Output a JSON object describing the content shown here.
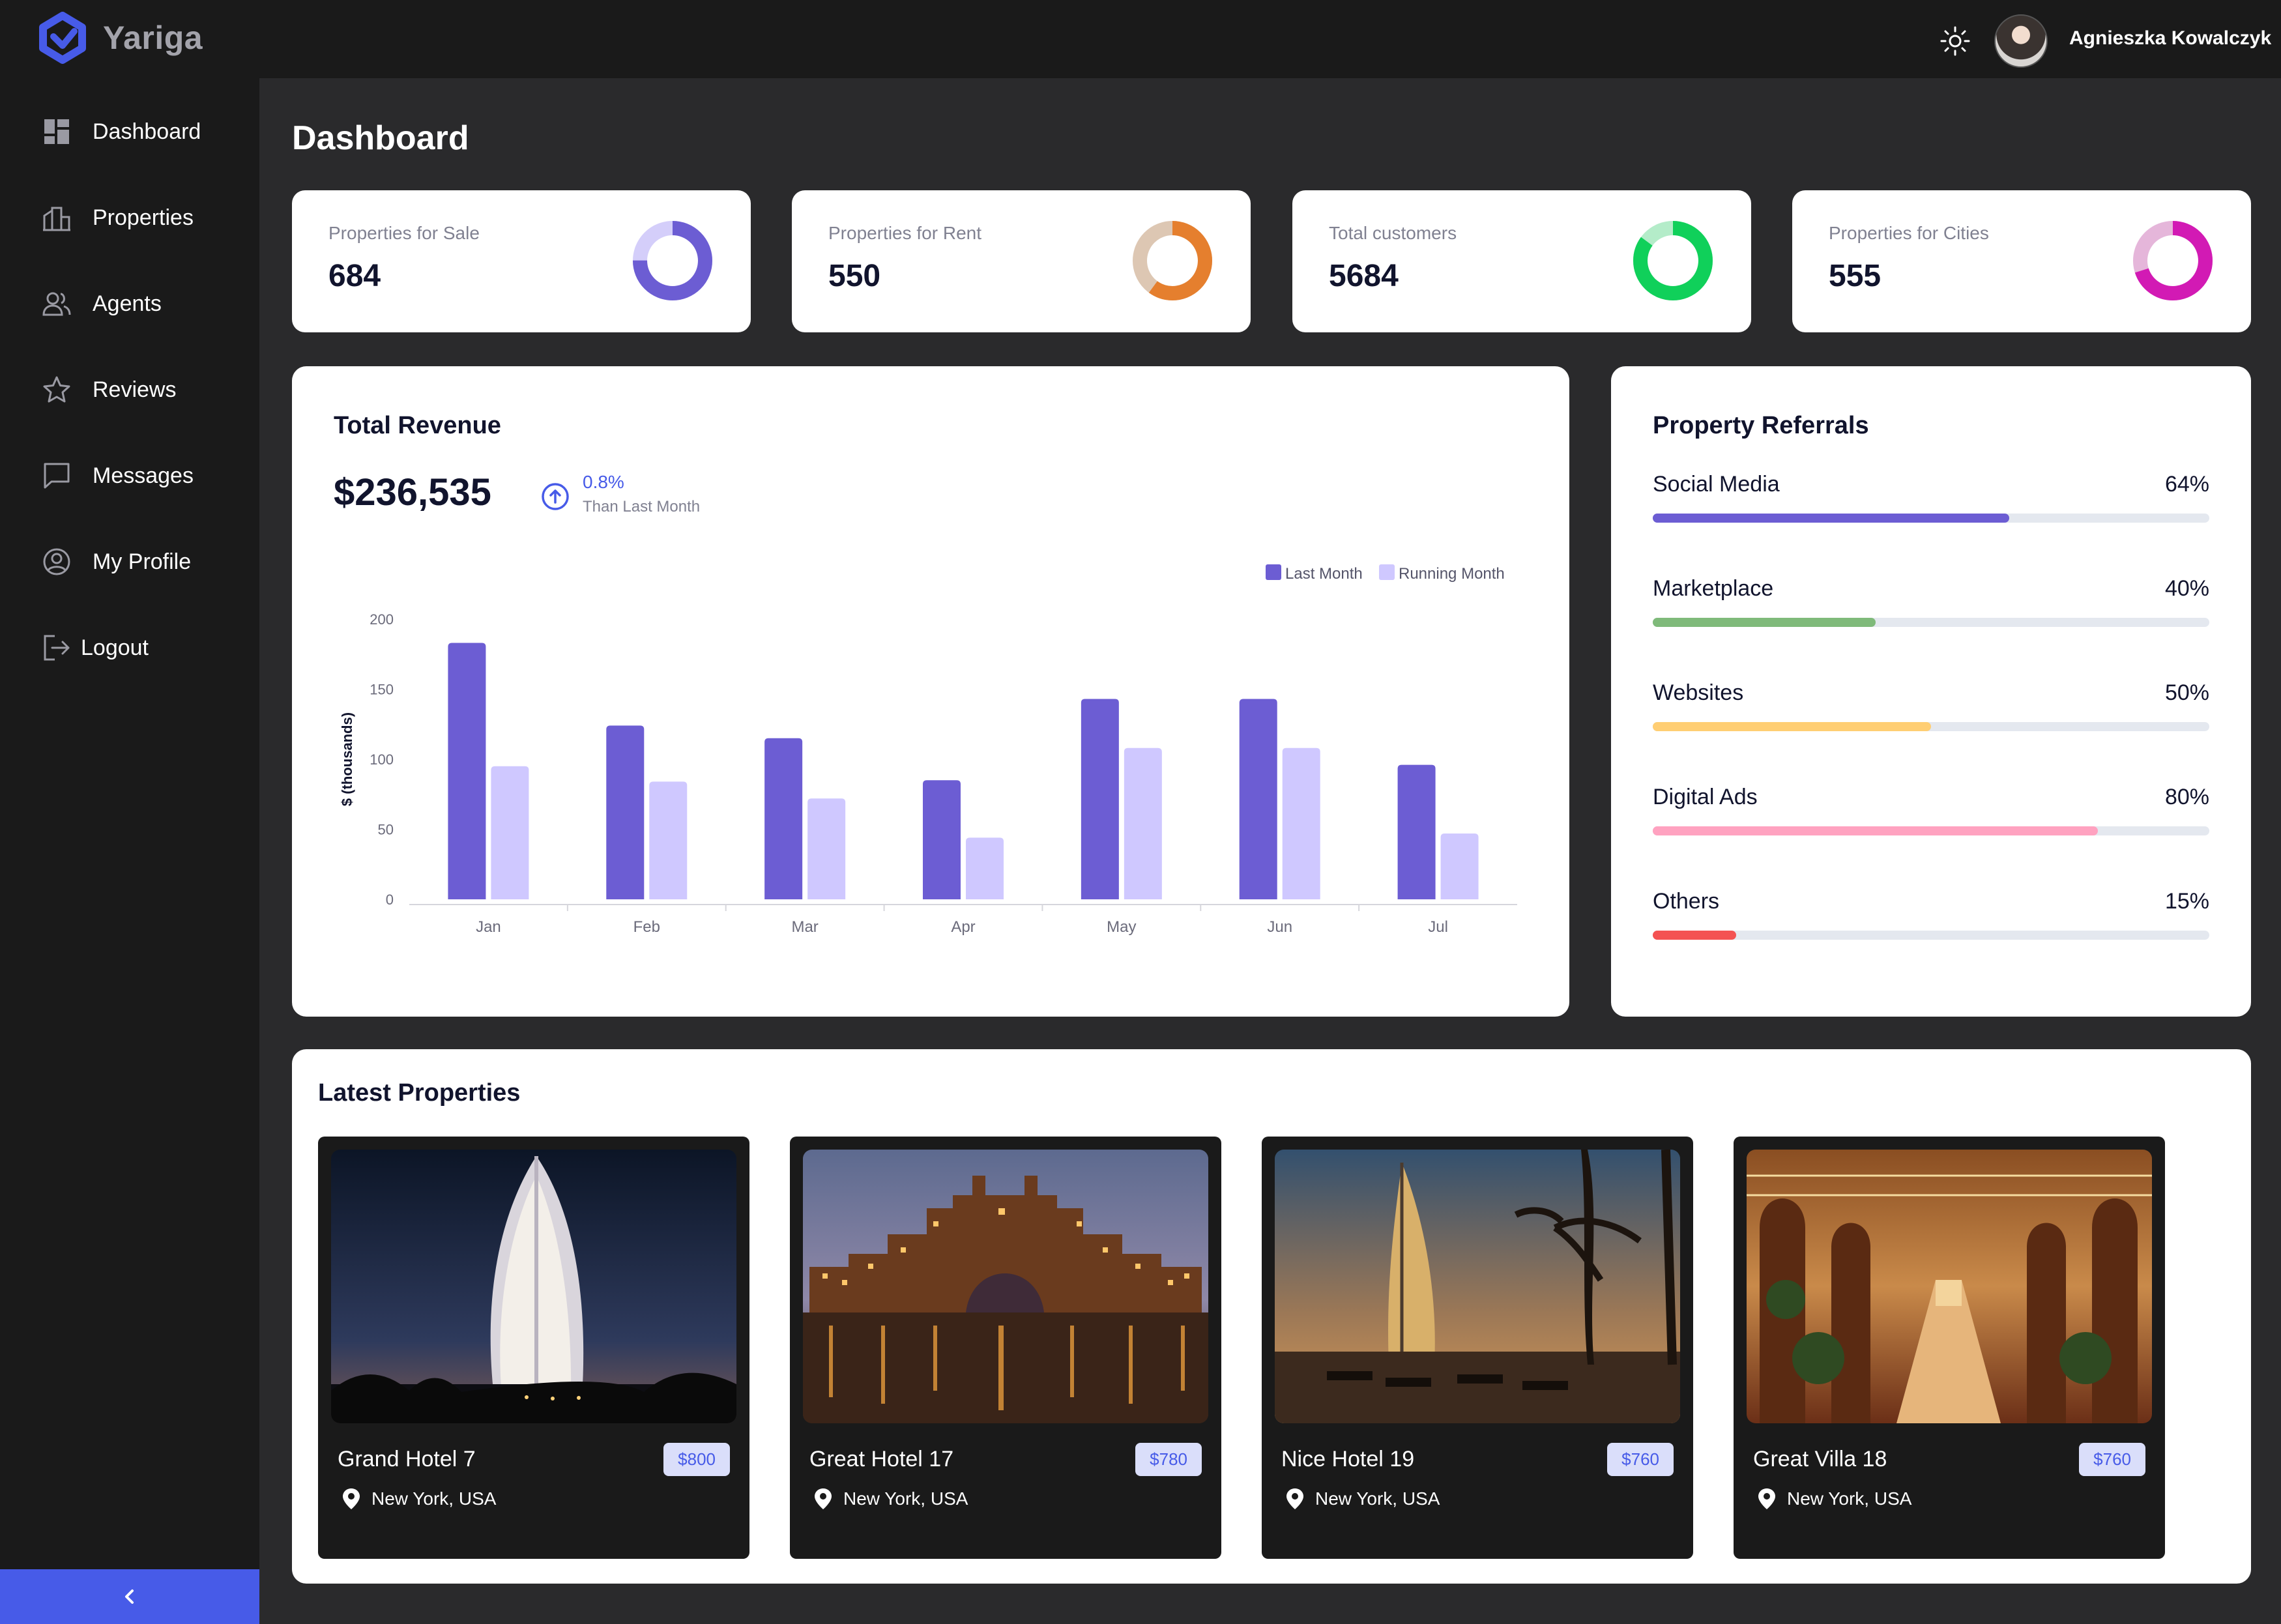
{
  "app": {
    "name": "Yariga"
  },
  "user": {
    "name": "Agnieszka Kowalczyk",
    "theme_icon": "sun-icon"
  },
  "sidebar": {
    "items": [
      {
        "label": "Dashboard",
        "icon": "dashboard-icon",
        "active": true
      },
      {
        "label": "Properties",
        "icon": "properties-icon"
      },
      {
        "label": "Agents",
        "icon": "agents-icon"
      },
      {
        "label": "Reviews",
        "icon": "star-icon"
      },
      {
        "label": "Messages",
        "icon": "message-icon"
      },
      {
        "label": "My Profile",
        "icon": "profile-icon"
      },
      {
        "label": "Logout",
        "icon": "logout-icon"
      }
    ],
    "collapse_icon": "chevron-left-icon"
  },
  "page": {
    "title": "Dashboard"
  },
  "stats": [
    {
      "label": "Properties for Sale",
      "value": "684",
      "fraction": 0.75,
      "colors": [
        "#6c5dd3",
        "#d4cefa"
      ]
    },
    {
      "label": "Properties for Rent",
      "value": "550",
      "fraction": 0.6,
      "colors": [
        "#e57f2e",
        "#ddc7b3"
      ]
    },
    {
      "label": "Total customers",
      "value": "5684",
      "fraction": 0.85,
      "colors": [
        "#10d05a",
        "#b4ecc9"
      ]
    },
    {
      "label": "Properties for Cities",
      "value": "555",
      "fraction": 0.7,
      "colors": [
        "#d21ab4",
        "#e5b6da"
      ]
    }
  ],
  "revenue": {
    "title": "Total Revenue",
    "amount": "$236,535",
    "change": "0.8%",
    "change_note": "Than Last Month",
    "trend_icon": "arrow-up-circle-icon"
  },
  "chart_data": {
    "type": "bar",
    "categories": [
      "Jan",
      "Feb",
      "Mar",
      "Apr",
      "May",
      "Jun",
      "Jul"
    ],
    "series": [
      {
        "name": "Last Month",
        "color": "#6c5dd3",
        "values": [
          183,
          124,
          115,
          85,
          143,
          143,
          96
        ]
      },
      {
        "name": "Running Month",
        "color": "#cfc8ff",
        "values": [
          95,
          84,
          72,
          44,
          108,
          108,
          47
        ]
      }
    ],
    "ylabel": "$ (thousands)",
    "ylim": [
      0,
      200
    ],
    "yticks": [
      0,
      50,
      100,
      150,
      200
    ],
    "legend_position": "top-right",
    "grid": false
  },
  "referrals": {
    "title": "Property Referrals",
    "items": [
      {
        "name": "Social Media",
        "percent": 64,
        "label": "64%",
        "color": "#6c5dd3"
      },
      {
        "name": "Marketplace",
        "percent": 40,
        "label": "40%",
        "color": "#7fba7a"
      },
      {
        "name": "Websites",
        "percent": 50,
        "label": "50%",
        "color": "#ffce73"
      },
      {
        "name": "Digital Ads",
        "percent": 80,
        "label": "80%",
        "color": "#ffa2c0"
      },
      {
        "name": "Others",
        "percent": 15,
        "label": "15%",
        "color": "#f45252"
      }
    ]
  },
  "latest": {
    "title": "Latest Properties",
    "items": [
      {
        "name": "Grand Hotel 7",
        "price": "$800",
        "location": "New York, USA",
        "pin_icon": "location-pin-icon"
      },
      {
        "name": "Great Hotel 17",
        "price": "$780",
        "location": "New York, USA",
        "pin_icon": "location-pin-icon"
      },
      {
        "name": "Nice Hotel 19",
        "price": "$760",
        "location": "New York, USA",
        "pin_icon": "location-pin-icon"
      },
      {
        "name": "Great Villa 18",
        "price": "$760",
        "location": "New York, USA",
        "pin_icon": "location-pin-icon"
      }
    ]
  }
}
